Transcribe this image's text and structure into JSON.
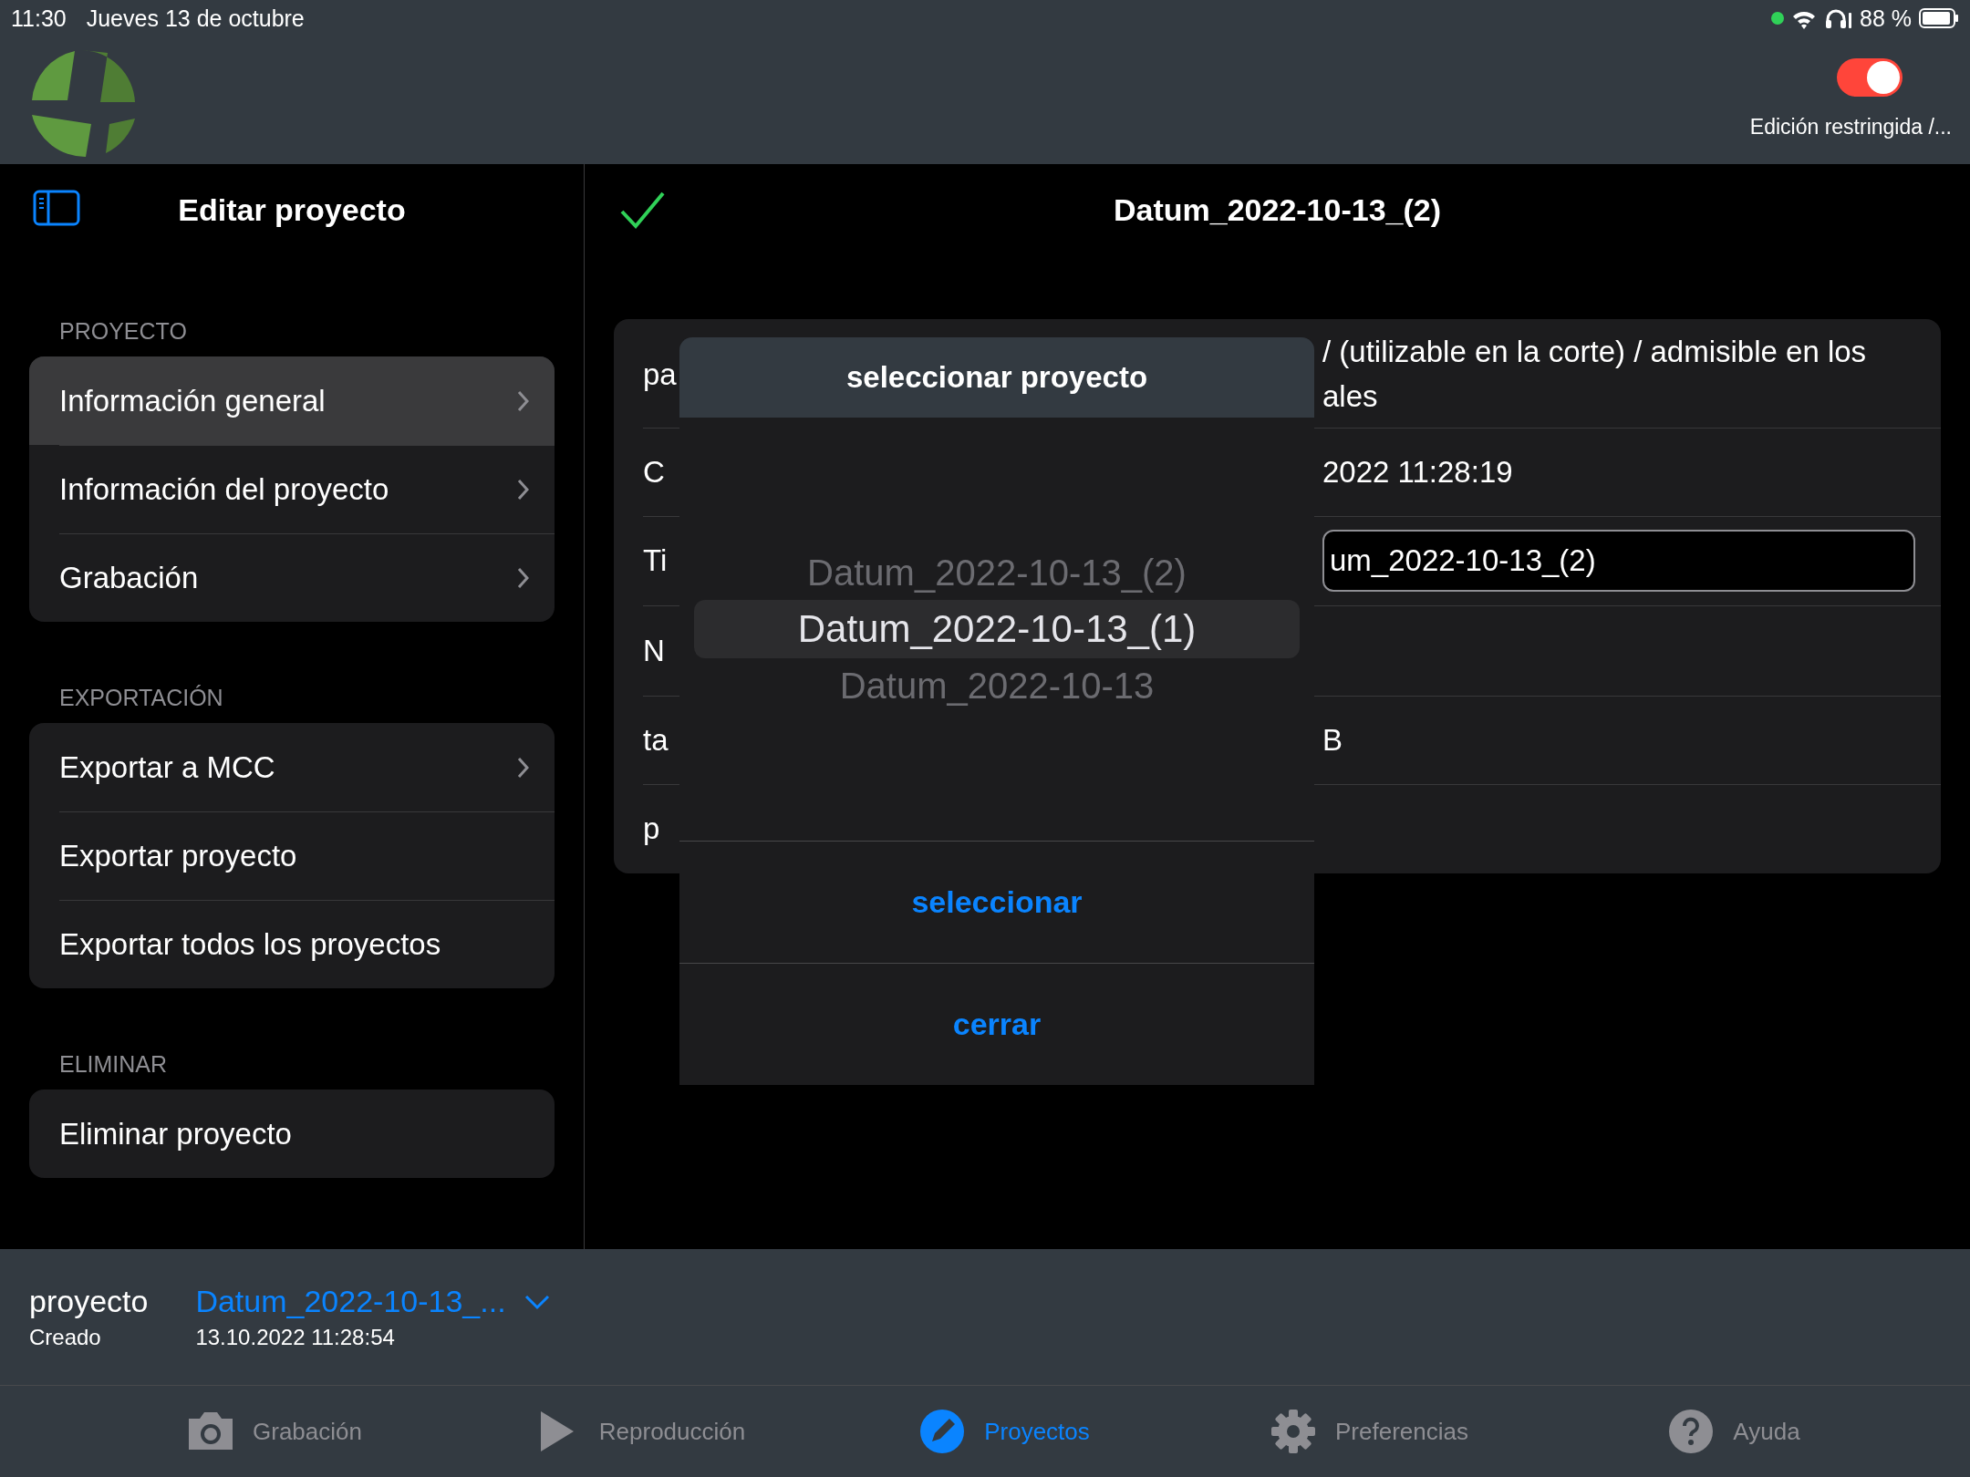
{
  "status_bar": {
    "time": "11:30",
    "date": "Jueves 13 de octubre",
    "battery": "88 %"
  },
  "header": {
    "restricted_toggle": {
      "label": "Edición restringida /...",
      "on": true
    }
  },
  "sidebar": {
    "title": "Editar proyecto",
    "sections": [
      {
        "heading": "PROYECTO",
        "items": [
          {
            "label": "Información general",
            "chevron": true,
            "selected": true
          },
          {
            "label": "Información del proyecto",
            "chevron": true,
            "selected": false
          },
          {
            "label": "Grabación",
            "chevron": true,
            "selected": false
          }
        ]
      },
      {
        "heading": "EXPORTACIÓN",
        "items": [
          {
            "label": "Exportar a MCC",
            "chevron": true,
            "selected": false
          },
          {
            "label": "Exportar proyecto",
            "chevron": false,
            "selected": false
          },
          {
            "label": "Exportar todos los proyectos",
            "chevron": false,
            "selected": false
          }
        ]
      },
      {
        "heading": "ELIMINAR",
        "items": [
          {
            "label": "Eliminar proyecto",
            "chevron": false,
            "selected": false
          }
        ]
      }
    ]
  },
  "detail": {
    "title": "Datum_2022-10-13_(2)",
    "rows": [
      {
        "kind": "text",
        "label": "pa",
        "value_lines": [
          "/ (utilizable en la corte) / admisible en los",
          "ales"
        ]
      },
      {
        "kind": "text",
        "label": "C",
        "value_lines": [
          "2022 11:28:19"
        ]
      },
      {
        "kind": "field",
        "label": "Ti",
        "value": "um_2022-10-13_(2)"
      },
      {
        "kind": "text",
        "label": "N",
        "value_lines": []
      },
      {
        "kind": "text",
        "label": "ta",
        "value_lines": [
          "B"
        ]
      },
      {
        "kind": "text",
        "label": "p",
        "value_lines": []
      }
    ]
  },
  "picker_dialog": {
    "title": "seleccionar proyecto",
    "options": [
      {
        "label": "Datum_2022-10-13_(2)",
        "selected": false
      },
      {
        "label": "Datum_2022-10-13_(1)",
        "selected": true
      },
      {
        "label": "Datum_2022-10-13",
        "selected": false
      }
    ],
    "buttons": [
      "seleccionar",
      "cerrar"
    ]
  },
  "project_bar": {
    "label": "proyecto",
    "created_label": "Creado",
    "project_name": "Datum_2022-10-13_...",
    "created": "13.10.2022 11:28:54"
  },
  "tab_bar": [
    {
      "label": "Grabación",
      "selected": false
    },
    {
      "label": "Reproducción",
      "selected": false
    },
    {
      "label": "Proyectos",
      "selected": true
    },
    {
      "label": "Preferencias",
      "selected": false
    },
    {
      "label": "Ayuda",
      "selected": false
    }
  ]
}
